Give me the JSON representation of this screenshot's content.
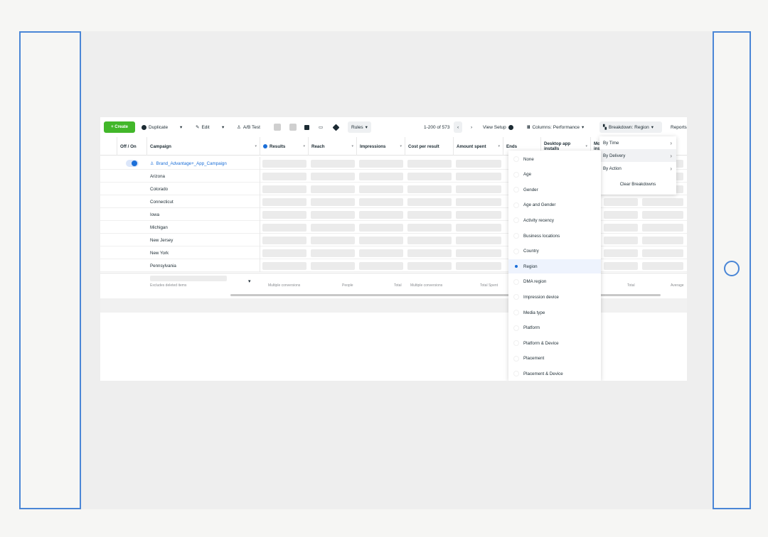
{
  "toolbar": {
    "create": "+ Create",
    "duplicate": "Duplicate",
    "edit": "Edit",
    "ab_test": "A/B Test",
    "rules": "Rules",
    "pagination": "1-200 of 573",
    "view_setup": "View Setup",
    "columns": "Columns: Performance",
    "breakdown": "Breakdown: Region",
    "reports": "Reports"
  },
  "columns": {
    "off_on": "Off / On",
    "campaign": "Campaign",
    "results": "Results",
    "reach": "Reach",
    "impressions": "Impressions",
    "cost_per_result": "Cost per result",
    "amount_spent": "Amount spent",
    "ends": "Ends",
    "desktop_app_installs": "Desktop app installs",
    "mo": "Mo ins"
  },
  "campaign": {
    "name": "Brand_Advantage+_App_Campaign",
    "regions": [
      "Arizona",
      "Colorado",
      "Connecticut",
      "Iowa",
      "Michigan",
      "New Jersey",
      "New York",
      "Pennsylvania"
    ]
  },
  "summary": {
    "excludes": "Excludes deleted items",
    "results": "Multiple conversions",
    "reach": "People",
    "impressions": "Total",
    "cost": "Multiple conversions",
    "spent": "Total Spent",
    "col_total": "Total",
    "col_avg": "Average"
  },
  "breakdown_menu": {
    "by_time": "By Time",
    "by_delivery": "By Delivery",
    "by_action": "By Action",
    "clear": "Clear Breakdowns"
  },
  "delivery_options": [
    "None",
    "Age",
    "Gender",
    "Age and Gender",
    "Activity recency",
    "Business locations",
    "Country",
    "Region",
    "DMA region",
    "Impression device",
    "Media type",
    "Platform",
    "Platform & Device",
    "Placement",
    "Placement & Device"
  ],
  "selected_option": "Region",
  "colors": {
    "accent": "#1a6ed8",
    "create": "#42b72a",
    "frame": "#4a86d6"
  }
}
